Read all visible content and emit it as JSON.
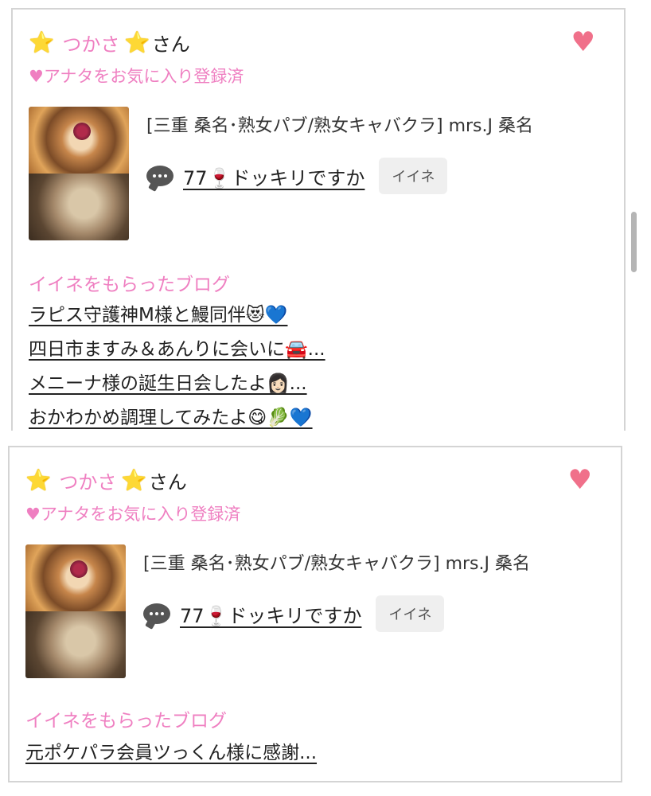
{
  "cards": [
    {
      "star_left": "⭐",
      "name": "つかさ",
      "star_right": "⭐",
      "suffix": "さん",
      "heart_icon": "♥",
      "favorite_label": "♥アナタをお気に入り登録済",
      "shop": "[三重 桑名･熟女パブ/熟女キャバクラ]  mrs.J 桑名",
      "blog_title": "77🍷ドッキリですか",
      "iine_label": "イイネ",
      "liked_heading": "イイネをもらったブログ",
      "liked_posts": [
        "ラピス守護神M様と鰻同伴😻💙",
        "四日市ますみ＆あんりに会いに🚘...",
        "メニーナ様の誕生日会したよ👩🏻...",
        "おかわかめ調理してみたよ😋🥬💙"
      ]
    },
    {
      "star_left": "⭐",
      "name": "つかさ",
      "star_right": "⭐",
      "suffix": "さん",
      "heart_icon": "♥",
      "favorite_label": "♥アナタをお気に入り登録済",
      "shop": "[三重 桑名･熟女パブ/熟女キャバクラ]  mrs.J 桑名",
      "blog_title": "77🍷ドッキリですか",
      "iine_label": "イイネ",
      "liked_heading": "イイネをもらったブログ",
      "liked_posts": [
        "元ポケパラ会員ツっくん様に感謝..."
      ]
    }
  ],
  "colors": {
    "accent_pink": "#ef7fc1",
    "heart": "#f0708a",
    "star": "#f5c21b"
  },
  "icons": {
    "speech_bubble": "speech-bubble-icon",
    "heart": "heart-icon",
    "star": "star-icon"
  }
}
